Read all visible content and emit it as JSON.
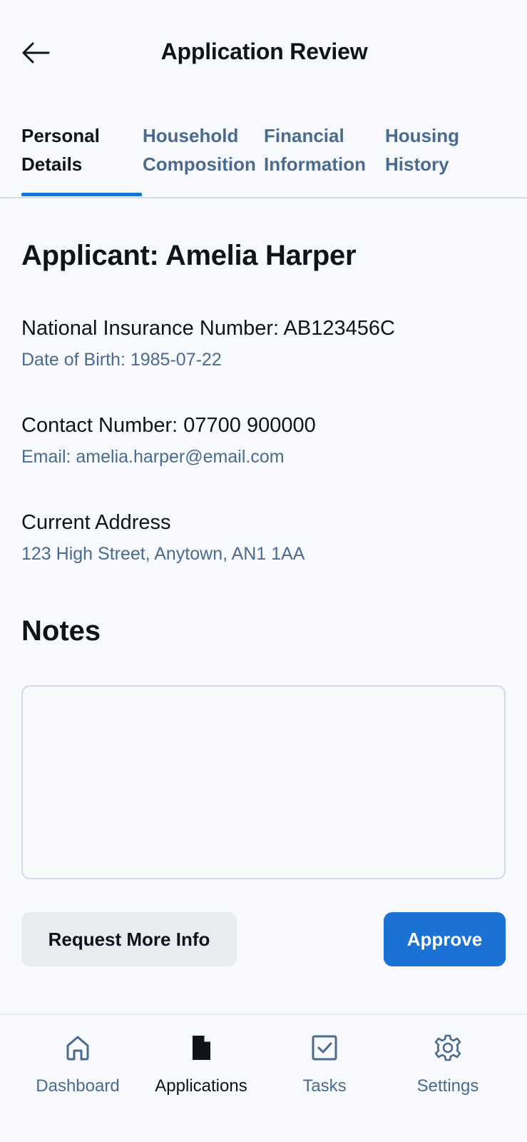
{
  "header": {
    "title": "Application Review",
    "back_icon": "arrow-left-icon"
  },
  "tabs": [
    {
      "label": "Personal\nDetails",
      "active": true
    },
    {
      "label": "Household\nComposition",
      "active": false
    },
    {
      "label": "Financial\nInformation",
      "active": false
    },
    {
      "label": "Housing\nHistory",
      "active": false
    }
  ],
  "applicant": {
    "heading": "Applicant: Amelia Harper",
    "ni_number": "National Insurance Number: AB123456C",
    "dob": "Date of Birth: 1985-07-22",
    "contact": "Contact Number: 07700 900000",
    "email": "Email: amelia.harper@email.com",
    "address_label": "Current Address",
    "address_value": "123 High Street, Anytown, AN1 1AA"
  },
  "notes": {
    "heading": "Notes",
    "value": "",
    "placeholder": ""
  },
  "actions": {
    "request_label": "Request More Info",
    "approve_label": "Approve"
  },
  "nav": [
    {
      "label": "Dashboard",
      "icon": "home-icon",
      "active": false
    },
    {
      "label": "Applications",
      "icon": "document-icon",
      "active": true
    },
    {
      "label": "Tasks",
      "icon": "checkbox-icon",
      "active": false
    },
    {
      "label": "Settings",
      "icon": "gear-icon",
      "active": false
    }
  ],
  "colors": {
    "accent": "#1a72d5",
    "secondary_text": "#4a6b8e",
    "primary_text": "#0f141a",
    "background": "#f7f9fc"
  }
}
